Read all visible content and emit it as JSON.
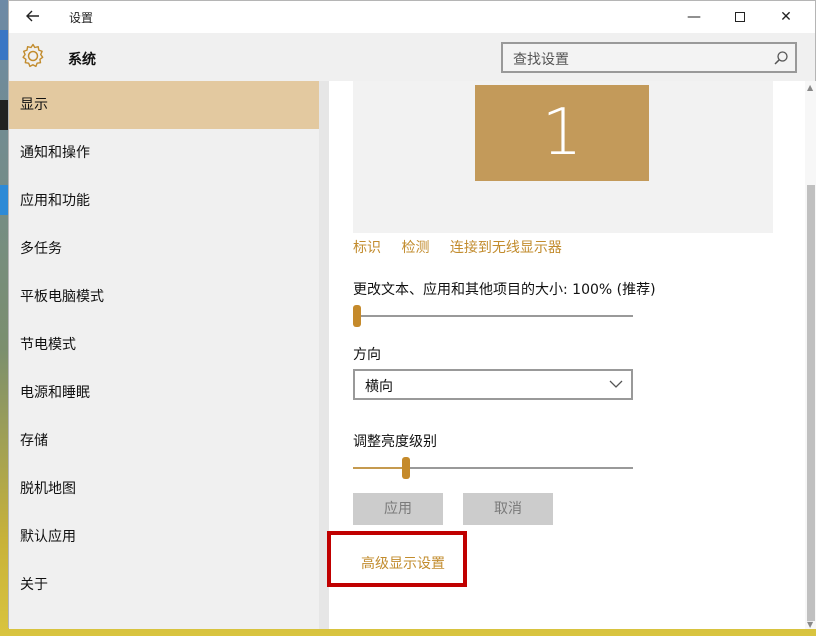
{
  "titlebar": {
    "back_icon": "arrow-left-icon",
    "title": "设置",
    "minimize": "—",
    "close": "✕"
  },
  "header": {
    "section_title": "系统",
    "search_placeholder": "查找设置"
  },
  "sidebar": {
    "items": [
      {
        "label": "显示",
        "active": true
      },
      {
        "label": "通知和操作"
      },
      {
        "label": "应用和功能"
      },
      {
        "label": "多任务"
      },
      {
        "label": "平板电脑模式"
      },
      {
        "label": "节电模式"
      },
      {
        "label": "电源和睡眠"
      },
      {
        "label": "存储"
      },
      {
        "label": "脱机地图"
      },
      {
        "label": "默认应用"
      },
      {
        "label": "关于"
      }
    ]
  },
  "display": {
    "monitor_number": "1",
    "links": {
      "identify": "标识",
      "detect": "检测",
      "wireless": "连接到无线显示器"
    },
    "scale_label": "更改文本、应用和其他项目的大小: 100% (推荐)",
    "scale_value": 0,
    "orientation_label": "方向",
    "orientation_value": "横向",
    "brightness_label": "调整亮度级别",
    "brightness_value": 0.18,
    "apply_button": "应用",
    "cancel_button": "取消",
    "advanced_link": "高级显示设置"
  },
  "colors": {
    "accent": "#c28c2e",
    "highlight_box": "#c00000",
    "monitor_fill": "#c39a5a"
  }
}
